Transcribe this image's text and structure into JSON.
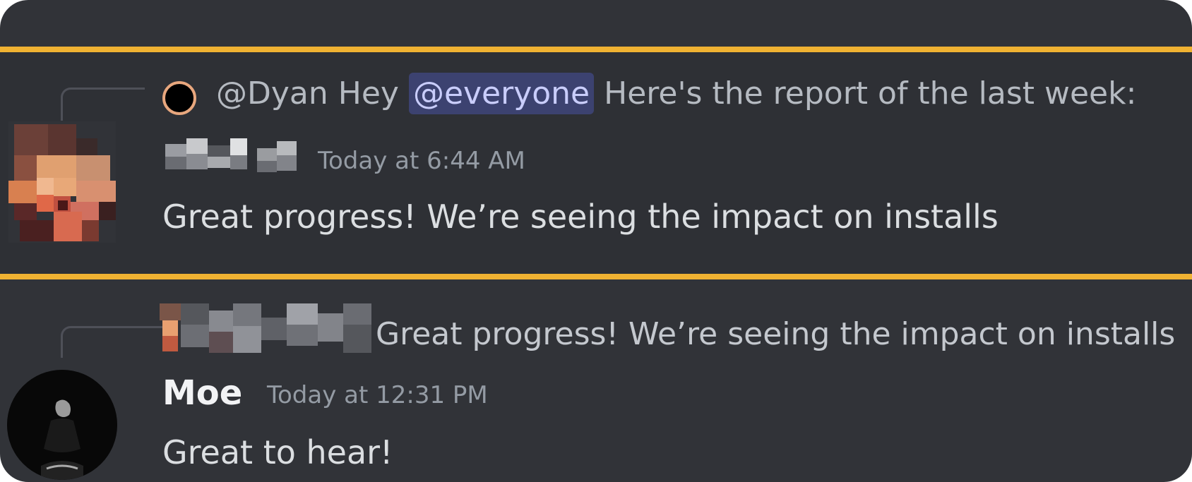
{
  "messages": [
    {
      "reply": {
        "text_before": "@Dyan Hey ",
        "mention": "@everyone",
        "text_after": " Here's the report of the last week:"
      },
      "author_hidden": true,
      "timestamp": "Today at 6:44 AM",
      "text": "Great progress! We’re seeing the impact on installs",
      "highlighted": true
    },
    {
      "reply": {
        "text": "Great progress! We’re seeing the impact on installs"
      },
      "author": "Moe",
      "timestamp": "Today at 12:31 PM",
      "text": "Great to hear!"
    }
  ],
  "colors": {
    "background": "#313338",
    "highlight_border": "#f0b232",
    "mention_background": "#3c4270",
    "mention_text": "#c9cdfb"
  }
}
